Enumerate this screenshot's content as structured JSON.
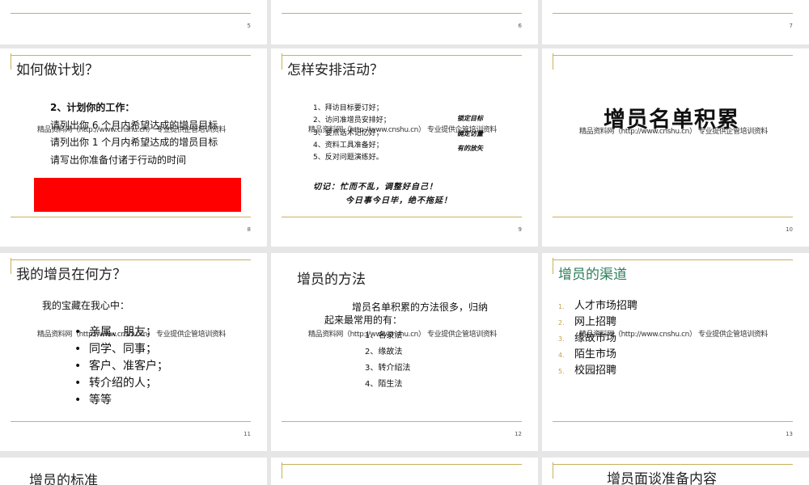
{
  "colors": {
    "accent_line": "#c9b15a",
    "red_box": "#ff0000",
    "title_green": "#2e7d5b"
  },
  "slides": {
    "s5": {
      "num": "5"
    },
    "s6": {
      "num": "6"
    },
    "s7": {
      "num": "7"
    },
    "s8": {
      "num": "8",
      "title": "如何做计划？",
      "heading": "2、计划你的工作：",
      "lines": [
        "请列出你 6 个月内希望达成的增员目标",
        "请列出你 1 个月内希望达成的增员目标",
        "请写出你准备付诸于行动的时间"
      ],
      "watermark": "精品资料网（http://www.cnshu.cn） 专业提供企管培训资料"
    },
    "s9": {
      "num": "9",
      "title": "怎样安排活动？",
      "lines": [
        "1、拜访目标要订好；",
        "2、访问准增员安排好；",
        "3、要点话术记忆好；",
        "4、资料工具准备好；",
        "5、反对问题演练好。"
      ],
      "side": [
        "锁定目标",
        "确定访量",
        "有的放矢"
      ],
      "note1": "切记：忙而不乱，调整好自己！",
      "note2": "今日事今日毕，绝不拖延！",
      "watermark": "精品资料网（http://www.cnshu.cn） 专业提供企管培训资料"
    },
    "s10": {
      "num": "10",
      "title": "增员名单积累",
      "watermark": "精品资料网（http://www.cnshu.cn） 专业提供企管培训资料"
    },
    "s11": {
      "num": "11",
      "title": "我的增员在何方？",
      "intro": "我的宝藏在我心中：",
      "items": [
        "亲属、朋友；",
        "同学、同事；",
        "客户、准客户；",
        "转介绍的人；",
        "等等"
      ],
      "watermark": "精品资料网（http://www.cnshu.cn） 专业提供企管培训资料"
    },
    "s12": {
      "num": "12",
      "title": "增员的方法",
      "intro1": "增员名单积累的方法很多，归纳",
      "intro2": "起来最常用的有：",
      "items": [
        "1、名录法",
        "2、缘故法",
        "3、转介绍法",
        "4、陌生法"
      ],
      "watermark": "精品资料网（http://www.cnshu.cn） 专业提供企管培训资料"
    },
    "s13": {
      "num": "13",
      "title": "增员的渠道",
      "items": [
        "人才市场招聘",
        "网上招聘",
        "缘故市场",
        "陌生市场",
        "校园招聘"
      ],
      "item_numbers": [
        "1.",
        "2.",
        "3.",
        "4.",
        "5."
      ],
      "watermark": "精品资料网（http://www.cnshu.cn） 专业提供企管培训资料"
    },
    "s14": {
      "title": "增员的标准"
    },
    "s16": {
      "title": "增员面谈准备内容"
    }
  }
}
